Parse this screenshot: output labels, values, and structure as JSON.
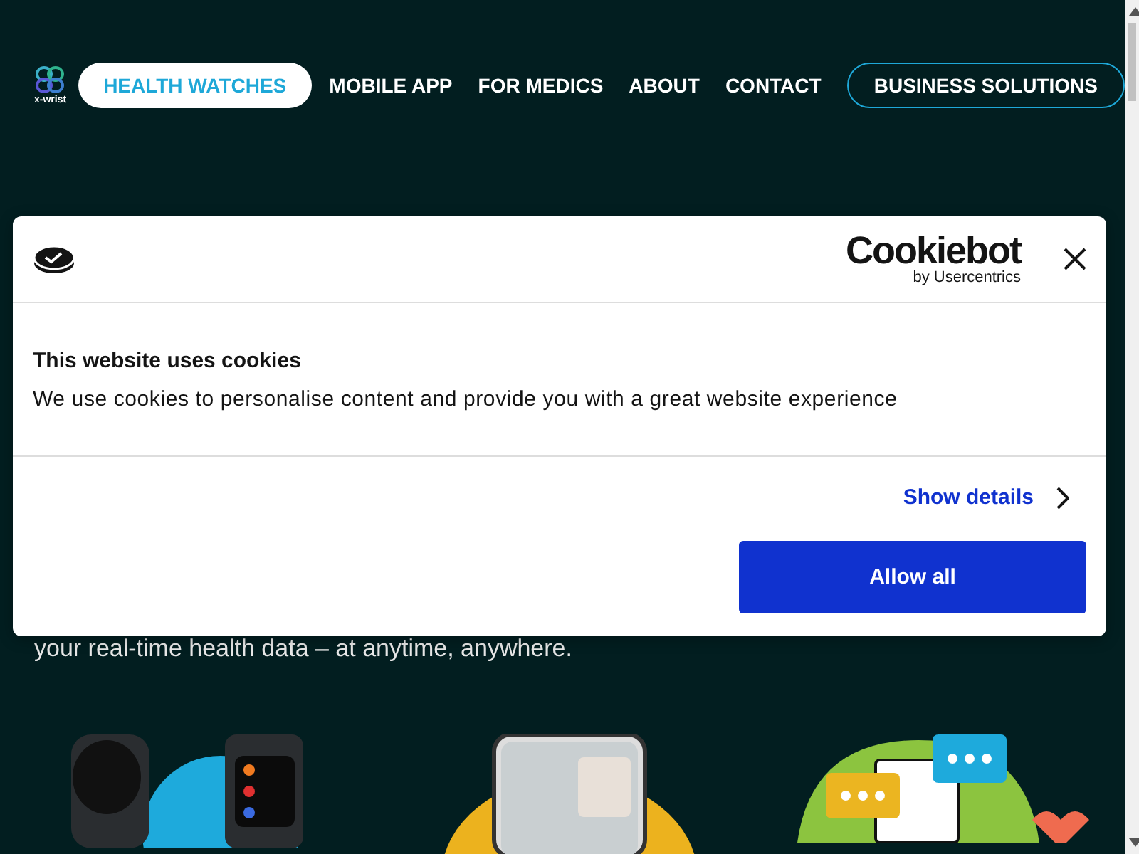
{
  "header": {
    "logo_text": "x-wrist",
    "nav": [
      {
        "label": "HEALTH WATCHES",
        "selected": true
      },
      {
        "label": "MOBILE APP",
        "selected": false
      },
      {
        "label": "FOR MEDICS",
        "selected": false
      },
      {
        "label": "ABOUT",
        "selected": false
      },
      {
        "label": "CONTACT",
        "selected": false
      }
    ],
    "cta": "BUSINESS SOLUTIONS"
  },
  "hero": {
    "subtitle": "your real-time health data – at anytime, anywhere."
  },
  "cookie_dialog": {
    "brand": "Cookiebot",
    "brand_sub": "by Usercentrics",
    "title": "This website uses cookies",
    "text": "We use cookies to personalise content and provide you with a great website experience",
    "details_link": "Show details",
    "allow_button": "Allow all"
  }
}
